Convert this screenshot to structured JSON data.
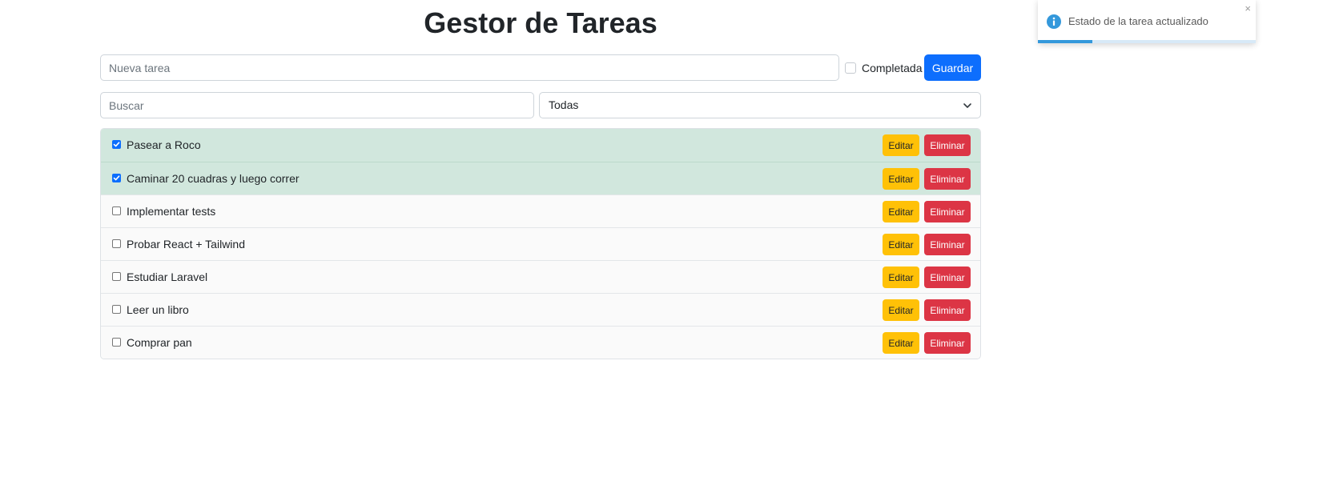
{
  "title": "Gestor de Tareas",
  "new_task": {
    "placeholder": "Nueva tarea",
    "value": "",
    "completed_label": "Completada",
    "completed_checked": false,
    "save_label": "Guardar"
  },
  "filter": {
    "search_placeholder": "Buscar",
    "search_value": "",
    "select_value": "Todas"
  },
  "tasks": [
    {
      "text": "Pasear a Roco",
      "done": true,
      "edit_label": "Editar",
      "delete_label": "Eliminar"
    },
    {
      "text": "Caminar 20 cuadras y luego correr",
      "done": true,
      "edit_label": "Editar",
      "delete_label": "Eliminar"
    },
    {
      "text": "Implementar tests",
      "done": false,
      "edit_label": "Editar",
      "delete_label": "Eliminar"
    },
    {
      "text": "Probar React + Tailwind",
      "done": false,
      "edit_label": "Editar",
      "delete_label": "Eliminar"
    },
    {
      "text": "Estudiar Laravel",
      "done": false,
      "edit_label": "Editar",
      "delete_label": "Eliminar"
    },
    {
      "text": "Leer un libro",
      "done": false,
      "edit_label": "Editar",
      "delete_label": "Eliminar"
    },
    {
      "text": "Comprar pan",
      "done": false,
      "edit_label": "Editar",
      "delete_label": "Eliminar"
    }
  ],
  "toast": {
    "message": "Estado de la tarea actualizado",
    "icon": "info-icon",
    "close_symbol": "×",
    "progress": 0.25
  },
  "colors": {
    "primary": "#0d6efd",
    "warning": "#ffc107",
    "danger": "#dc3545",
    "done_row": "#d1e7dd",
    "toast_info": "#3498db"
  }
}
